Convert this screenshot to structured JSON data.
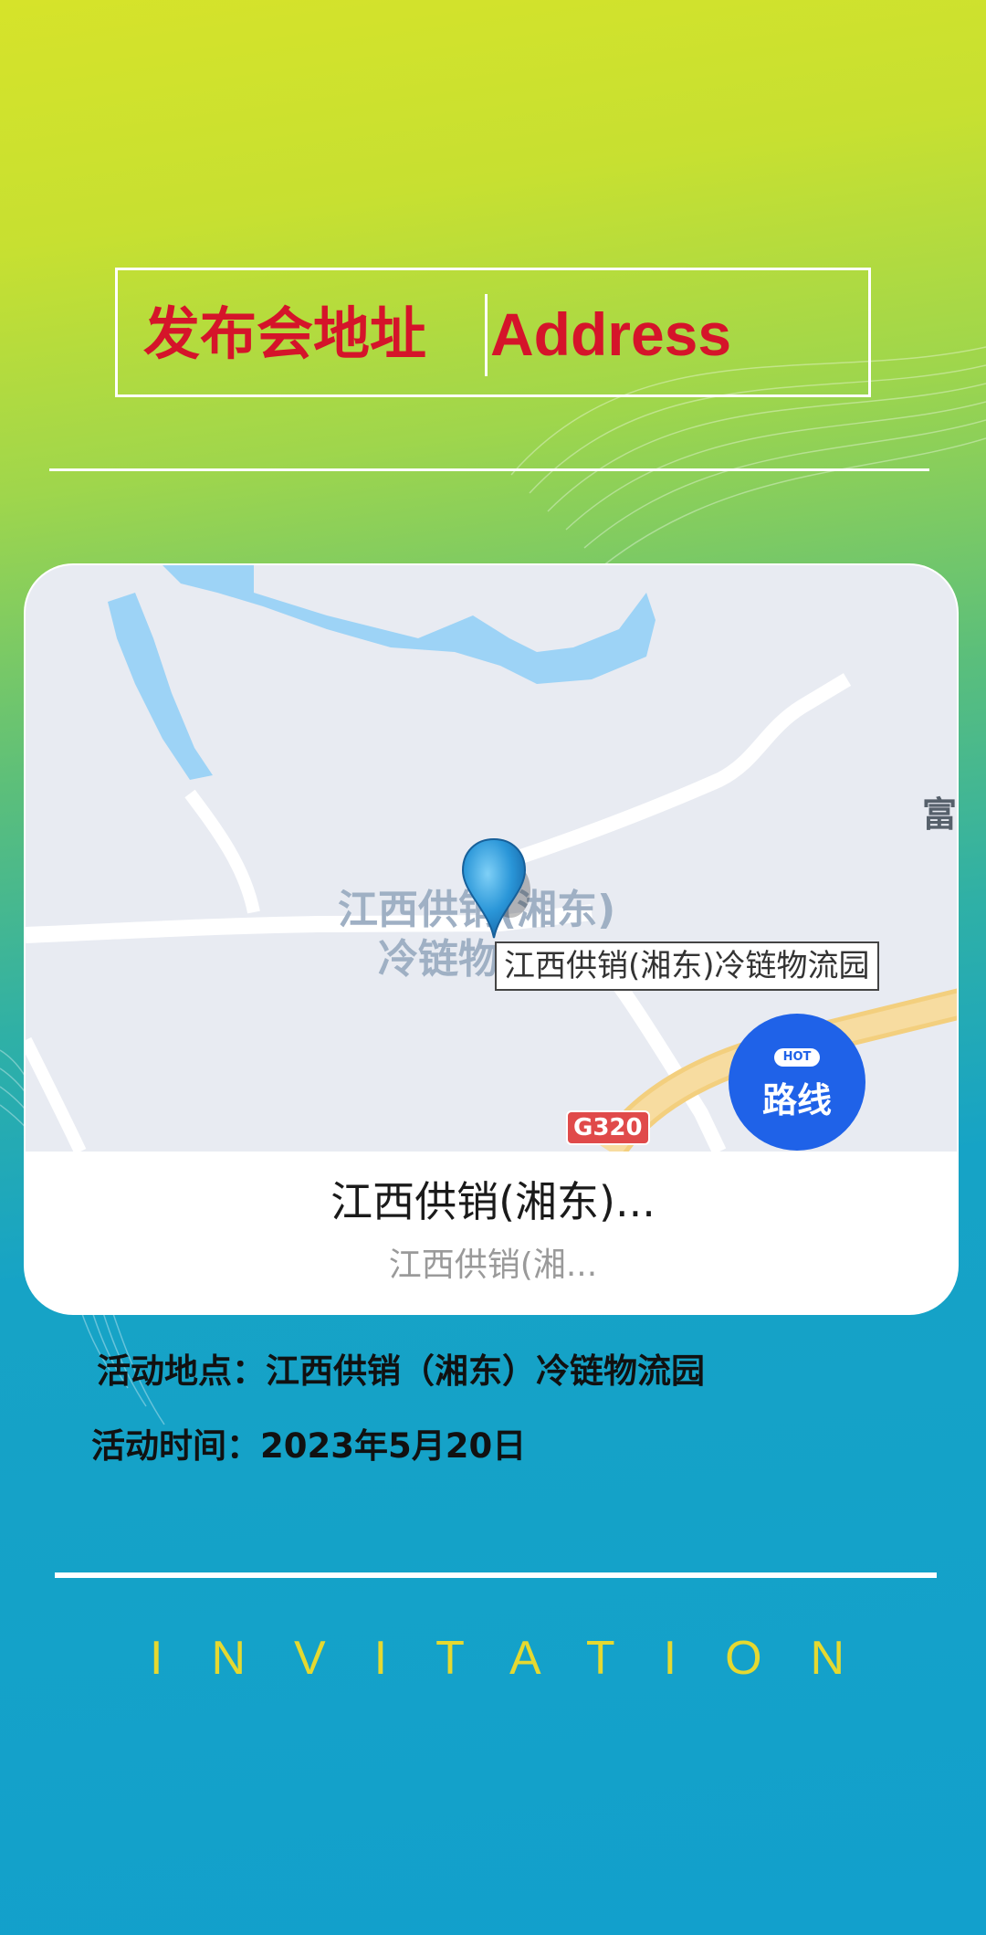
{
  "header": {
    "title_cn": "发布会地址",
    "title_en": "Address"
  },
  "map": {
    "label_line1": "江西供销(湘东)",
    "label_line2": "冷链物",
    "label_right": "富",
    "tooltip": "江西供销(湘东)冷链物流园",
    "road_badge": "G320",
    "route_button": {
      "hot_tag": "HOT",
      "label": "路线"
    }
  },
  "location_card": {
    "name": "江西供销(湘东)...",
    "subtitle": "江西供销(湘..."
  },
  "details": {
    "venue": "活动地点：江西供销（湘东）冷链物流园",
    "time": "活动时间：2023年5月20日"
  },
  "footer": {
    "invitation": "INVITATION"
  },
  "colors": {
    "title_red": "#d5142a",
    "route_blue": "#1f62e8",
    "invitation_yellow": "#e5d930"
  }
}
